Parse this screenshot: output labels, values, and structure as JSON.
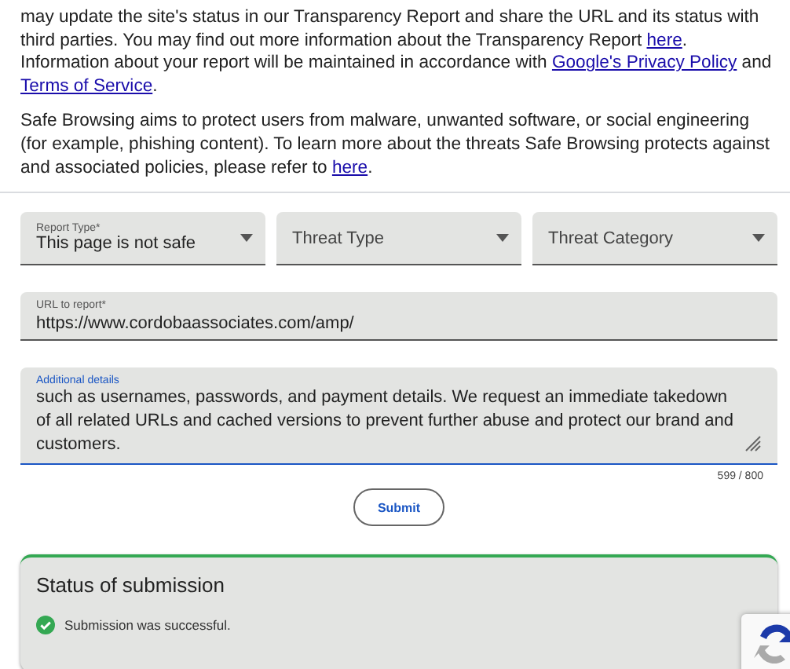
{
  "intro": [
    {
      "parts": [
        {
          "kind": "text",
          "text": "may update the site's status in our Transparency Report and share the URL and its status with third parties. You may find out more information about the Transparency Report "
        },
        {
          "kind": "link",
          "text": "here"
        },
        {
          "kind": "text",
          "text": ". Information about your report will be maintained in accordance with "
        },
        {
          "kind": "link",
          "text": "Google's Privacy Policy"
        },
        {
          "kind": "text",
          "text": " and "
        },
        {
          "kind": "link",
          "text": "Terms of Service"
        },
        {
          "kind": "text",
          "text": "."
        }
      ]
    },
    {
      "parts": [
        {
          "kind": "text",
          "text": "Safe Browsing aims to protect users from malware, unwanted software, or social engineering (for example, phishing content). To learn more about the threats Safe Browsing protects against and associated policies, please refer to "
        },
        {
          "kind": "link",
          "text": "here"
        },
        {
          "kind": "text",
          "text": "."
        }
      ]
    }
  ],
  "dropdowns": [
    {
      "label": "Report Type*",
      "value": "This page is not safe"
    },
    {
      "placeholder": "Threat Type"
    },
    {
      "placeholder": "Threat Category"
    }
  ],
  "url_field": {
    "label": "URL to report*",
    "value": "https://www.cordobaassociates.com/amp/"
  },
  "details_field": {
    "label": "Additional details",
    "value": "such as usernames, passwords, and payment details. We request an immediate takedown of all related URLs and cached versions to prevent further abuse and protect our brand and customers.",
    "counter": "599 / 800"
  },
  "submit_button": "Submit",
  "status": {
    "title": "Status of submission",
    "message": "Submission was successful."
  }
}
